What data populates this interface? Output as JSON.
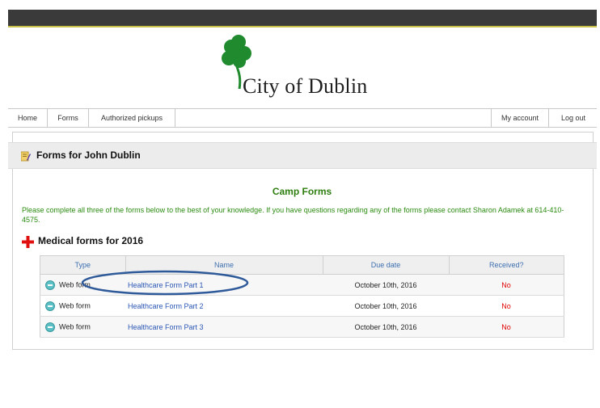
{
  "brand": {
    "name": "City of Dublin",
    "shamrock_color": "#1f8a2e"
  },
  "nav": {
    "left": [
      "Home",
      "Forms",
      "Authorized pickups"
    ],
    "right": [
      "My account",
      "Log out"
    ]
  },
  "forms_header": {
    "title": "Forms for John Dublin"
  },
  "camp": {
    "title": "Camp Forms",
    "instructions": "Please complete all three of the forms below to the best of your knowledge.  If you have questions regarding any of the forms please contact Sharon Adamek at 614-410-4575."
  },
  "medical": {
    "title": "Medical forms for 2016",
    "columns": [
      "Type",
      "Name",
      "Due date",
      "Received?"
    ],
    "rows": [
      {
        "type": "Web form",
        "name": "Healthcare Form Part 1",
        "due": "October 10th, 2016",
        "received": "No"
      },
      {
        "type": "Web form",
        "name": "Healthcare Form Part 2",
        "due": "October 10th, 2016",
        "received": "No"
      },
      {
        "type": "Web form",
        "name": "Healthcare Form Part 3",
        "due": "October 10th, 2016",
        "received": "No"
      }
    ]
  },
  "colors": {
    "accent_green": "#2e7d0f",
    "link_blue": "#2b56b5",
    "status_red": "#e10000",
    "annotation_ellipse": "#2f5a9a"
  }
}
